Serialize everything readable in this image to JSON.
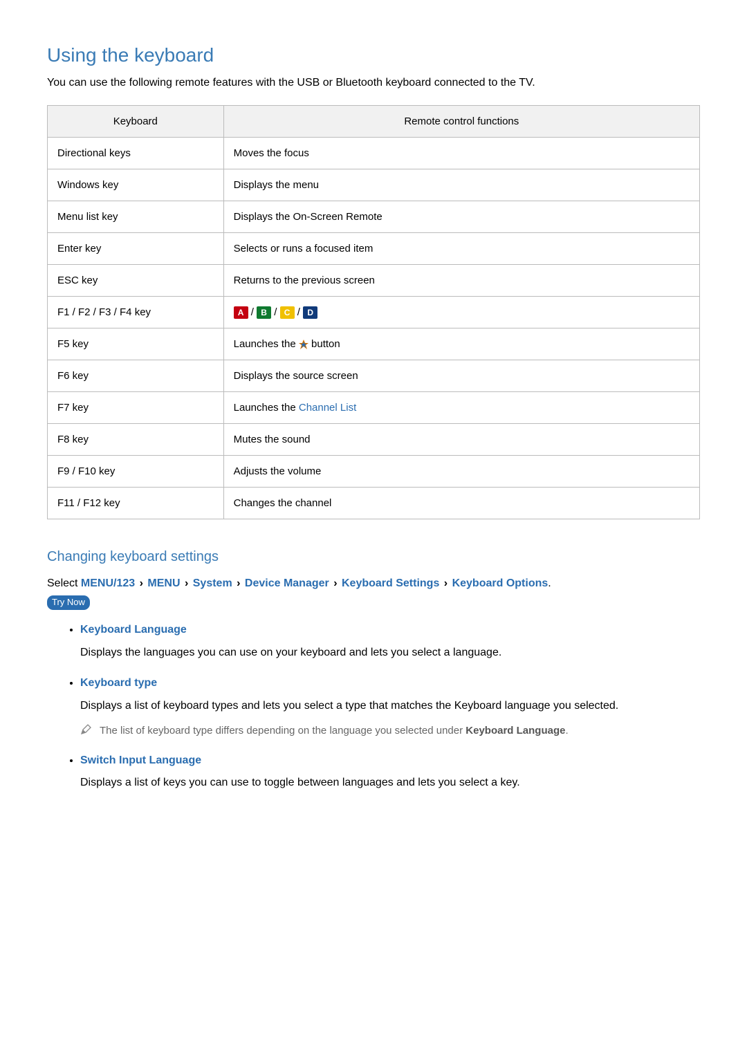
{
  "title": "Using the keyboard",
  "intro": "You can use the following remote features with the USB or Bluetooth keyboard connected to the TV.",
  "table": {
    "headers": {
      "kbd": "Keyboard",
      "func": "Remote control functions"
    },
    "rows": [
      {
        "kbd": "Directional keys",
        "func": "Moves the focus"
      },
      {
        "kbd": "Windows key",
        "func": "Displays the menu"
      },
      {
        "kbd": "Menu list key",
        "func": "Displays the On-Screen Remote"
      },
      {
        "kbd": "Enter key",
        "func": "Selects or runs a focused item"
      },
      {
        "kbd": "ESC key",
        "func": "Returns to the previous screen"
      },
      {
        "kbd": "F1 / F2 / F3 / F4 key",
        "func_abcd": {
          "a": "A",
          "b": "B",
          "c": "C",
          "d": "D",
          "sep": " / "
        }
      },
      {
        "kbd": "F5 key",
        "func_smart": {
          "pre": "Launches the ",
          "post": " button"
        }
      },
      {
        "kbd": "F6 key",
        "func": "Displays the source screen"
      },
      {
        "kbd": "F7 key",
        "func_link": {
          "pre": "Launches the ",
          "link": "Channel List"
        }
      },
      {
        "kbd": "F8 key",
        "func": "Mutes the sound"
      },
      {
        "kbd": "F9 / F10 key",
        "func": "Adjusts the volume"
      },
      {
        "kbd": "F11 / F12 key",
        "func": "Changes the channel"
      }
    ]
  },
  "section2": {
    "title": "Changing keyboard settings",
    "select_label": "Select ",
    "path": [
      "MENU/123",
      "MENU",
      "System",
      "Device Manager",
      "Keyboard Settings",
      "Keyboard Options"
    ],
    "path_end": ".",
    "trynow": "Try Now",
    "options": [
      {
        "title": "Keyboard Language",
        "desc": "Displays the languages you can use on your keyboard and lets you select a language."
      },
      {
        "title": "Keyboard type",
        "desc": "Displays a list of keyboard types and lets you select a type that matches the Keyboard language you selected.",
        "note": {
          "pre": "The list of keyboard type differs depending on the language you selected under ",
          "strong": "Keyboard Language",
          "post": "."
        }
      },
      {
        "title": "Switch Input Language",
        "desc": "Displays a list of keys you can use to toggle between languages and lets you select a key."
      }
    ]
  }
}
